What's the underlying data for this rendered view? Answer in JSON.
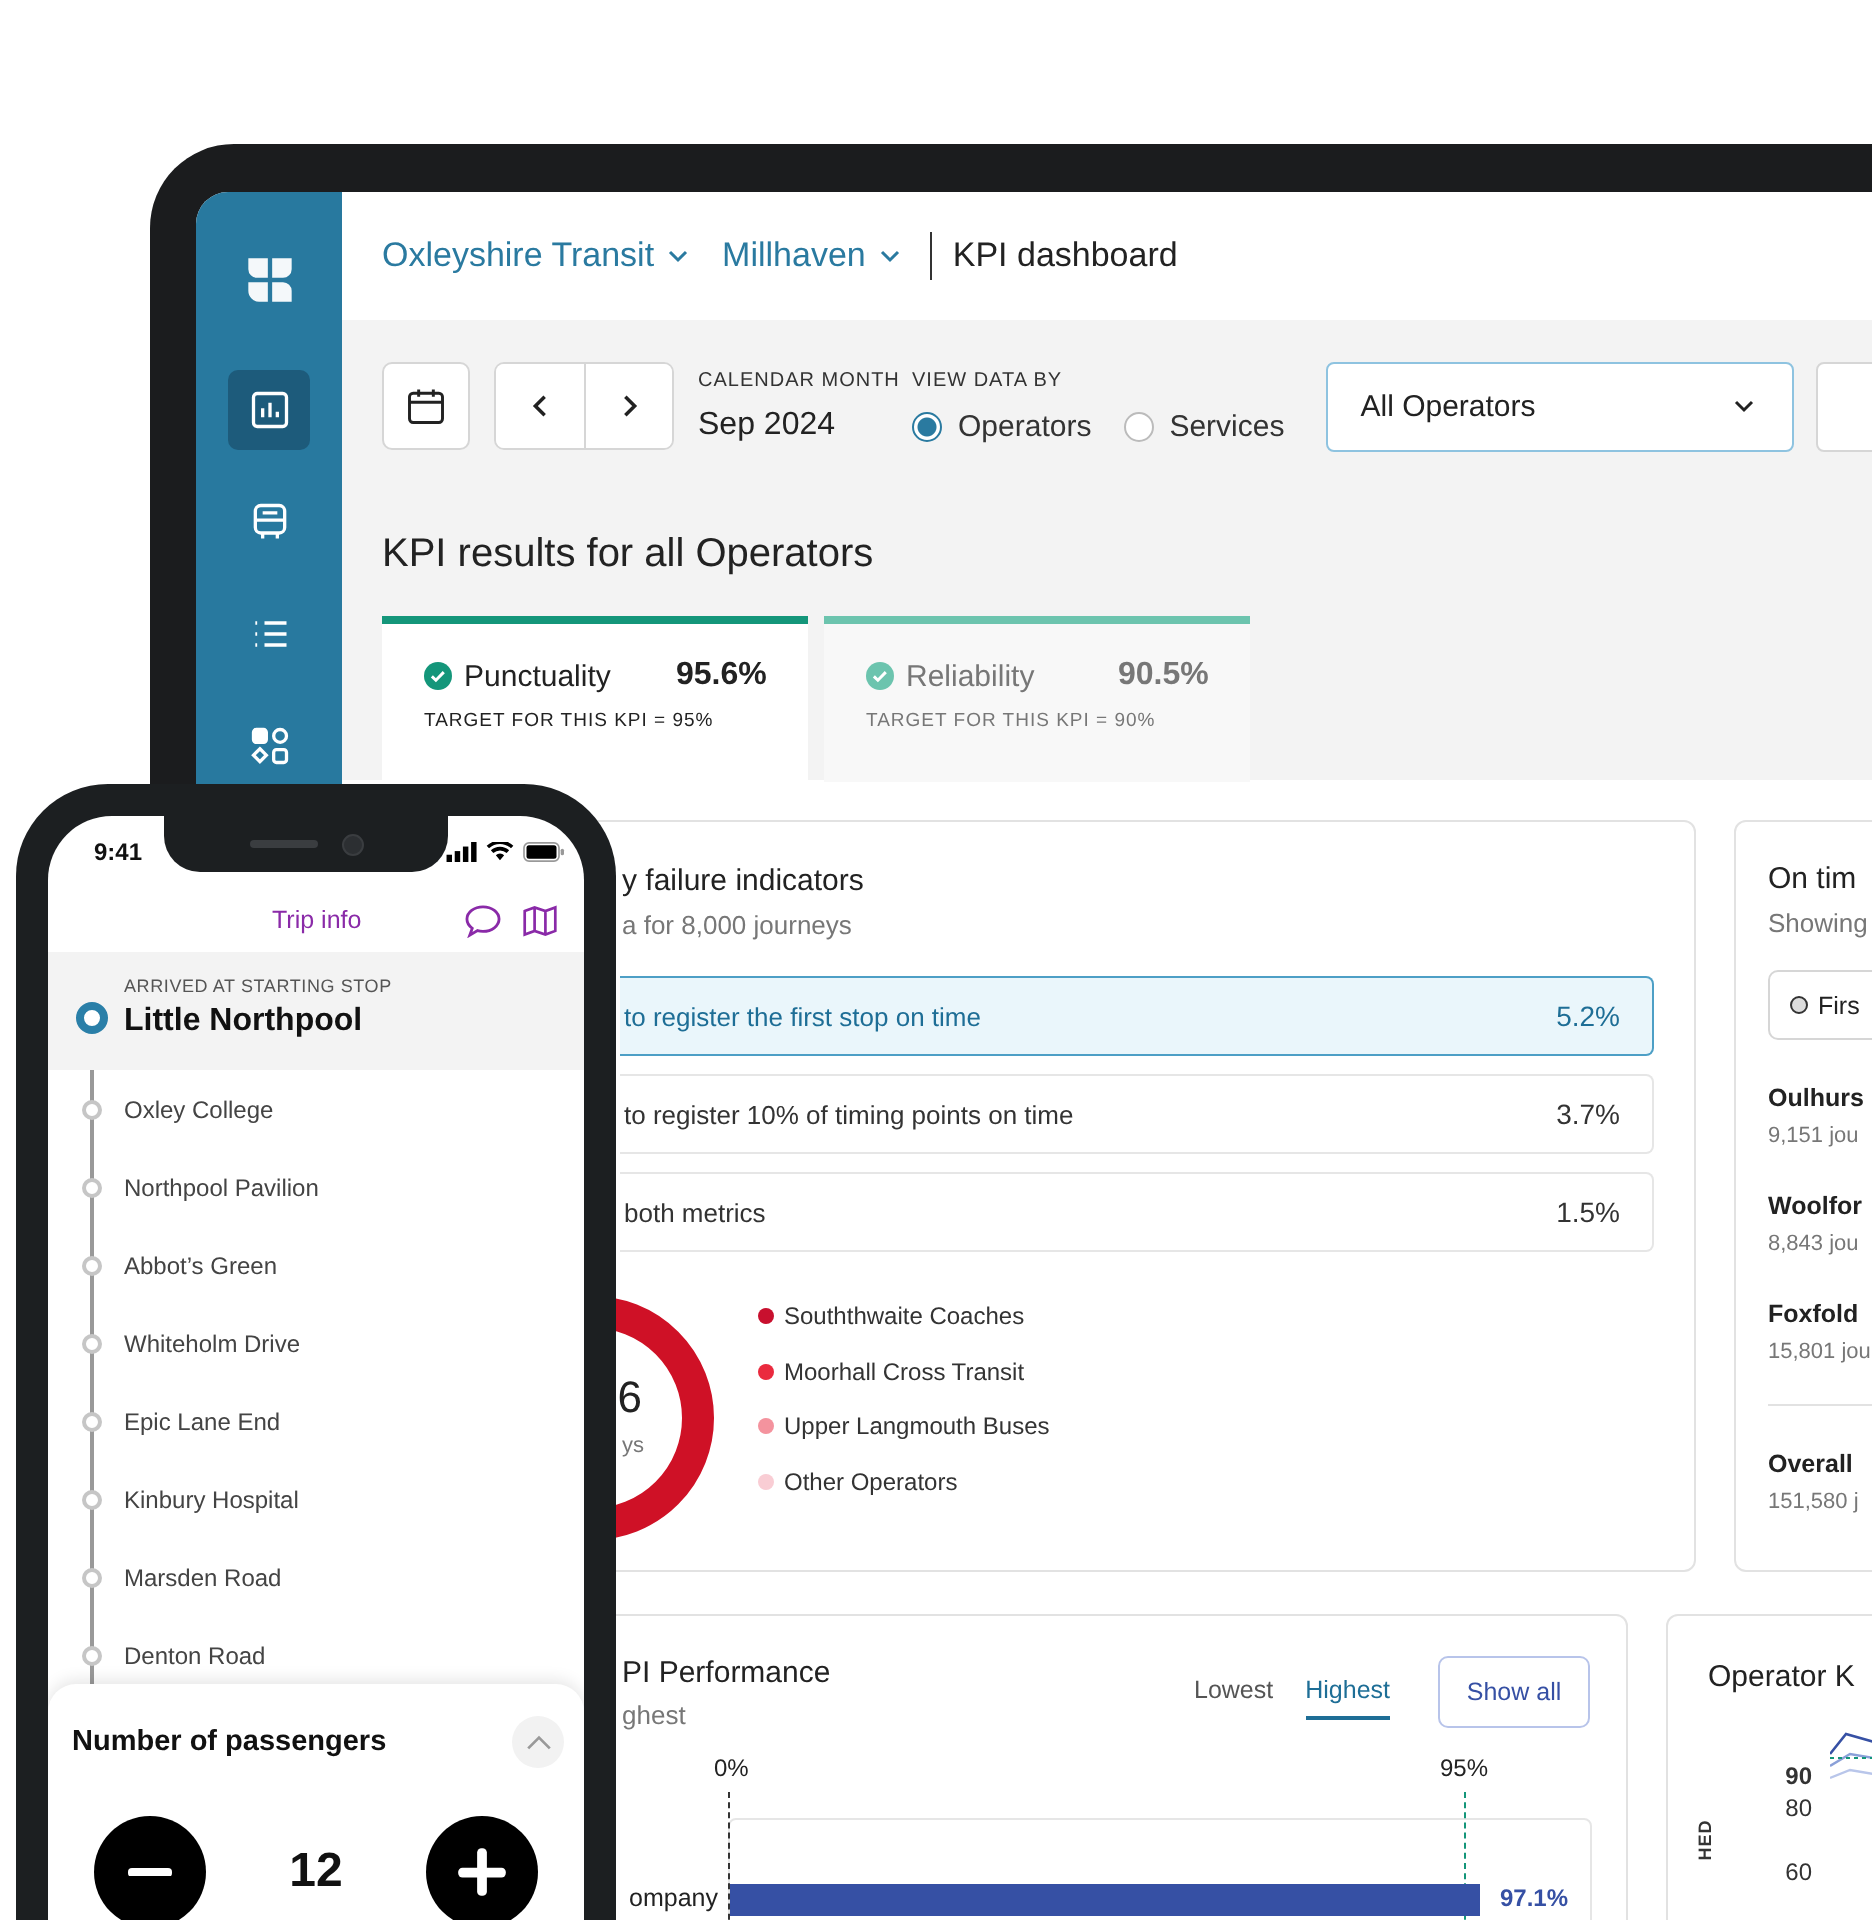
{
  "tablet": {
    "sidebar": {
      "items": [
        {
          "kind": "chart",
          "selected": true
        },
        {
          "kind": "bus",
          "selected": false
        },
        {
          "kind": "list",
          "selected": false
        },
        {
          "kind": "apps",
          "selected": false
        }
      ]
    },
    "breadcrumbs": [
      "Oxleyshire Transit",
      "Millhaven"
    ],
    "page_title": "KPI dashboard",
    "toolbar": {
      "month_label": "CALENDAR MONTH",
      "month": "Sep 2024",
      "view_label": "VIEW DATA BY",
      "view_options": [
        {
          "label": "Operators",
          "selected": true
        },
        {
          "label": "Services",
          "selected": false
        }
      ],
      "operator_select": "All Operators"
    },
    "heading": "KPI results for all Operators",
    "kpi_tabs": [
      {
        "name": "Punctuality",
        "value": "95.6%",
        "target": "TARGET FOR THIS KPI = 95%",
        "selected": true
      },
      {
        "name": "Reliability",
        "value": "90.5%",
        "target": "TARGET FOR THIS KPI = 90%",
        "selected": false
      }
    ],
    "failure_card": {
      "title": "y failure indicators",
      "subtitle": "a for 8,000 journeys",
      "rows": [
        {
          "label": "to register the first stop on time",
          "value": "5.2%",
          "selected": true
        },
        {
          "label": "to register 10% of timing points on time",
          "value": "3.7%",
          "selected": false
        },
        {
          "label": "both metrics",
          "value": "1.5%",
          "selected": false
        }
      ],
      "donut_value": "6",
      "donut_caption": "ys",
      "legend": [
        {
          "label": "Souththwaite Coaches",
          "color": "#c8102e"
        },
        {
          "label": "Moorhall Cross Transit",
          "color": "#ea2a3e"
        },
        {
          "label": "Upper Langmouth Buses",
          "color": "#f4939e"
        },
        {
          "label": "Other Operators",
          "color": "#f9cdd4"
        }
      ]
    },
    "on_time_card": {
      "title": "On tim",
      "subtitle": "Showing",
      "filter": "Firs",
      "operators": [
        {
          "name": "Oulhurs",
          "journeys": "9,151 jou"
        },
        {
          "name": "Woolfor",
          "journeys": "8,843 jou"
        },
        {
          "name": "Foxfold",
          "journeys": "15,801 jou"
        }
      ],
      "overall": {
        "name": "Overall",
        "journeys": "151,580 j"
      }
    },
    "performance_card": {
      "title": "PI Performance",
      "subtitle": "ghest",
      "sort_options": [
        {
          "label": "Lowest",
          "selected": false
        },
        {
          "label": "Highest",
          "selected": true
        }
      ],
      "show_all": "Show all",
      "scale_labels": [
        "0%",
        "95%"
      ],
      "bars": [
        {
          "label": "ompany",
          "value": "97.1%",
          "level": 0.873
        }
      ]
    },
    "operator_card": {
      "title": "Operator K",
      "y_axis_label": "HED",
      "ticks": [
        "90",
        "80",
        "60"
      ]
    }
  },
  "phone": {
    "time": "9:41",
    "title": "Trip info",
    "stops": [
      {
        "name": "Little Northpool",
        "status": "ARRIVED AT STARTING STOP",
        "current": true
      },
      {
        "name": "Oxley College",
        "current": false
      },
      {
        "name": "Northpool Pavilion",
        "current": false
      },
      {
        "name": "Abbot’s Green",
        "current": false
      },
      {
        "name": "Whiteholm Drive",
        "current": false
      },
      {
        "name": "Epic Lane End",
        "current": false
      },
      {
        "name": "Kinbury Hospital",
        "current": false
      },
      {
        "name": "Marsden Road",
        "current": false
      },
      {
        "name": "Denton Road",
        "current": false
      }
    ],
    "sheet": {
      "title": "Number of passengers",
      "count": "12"
    }
  }
}
